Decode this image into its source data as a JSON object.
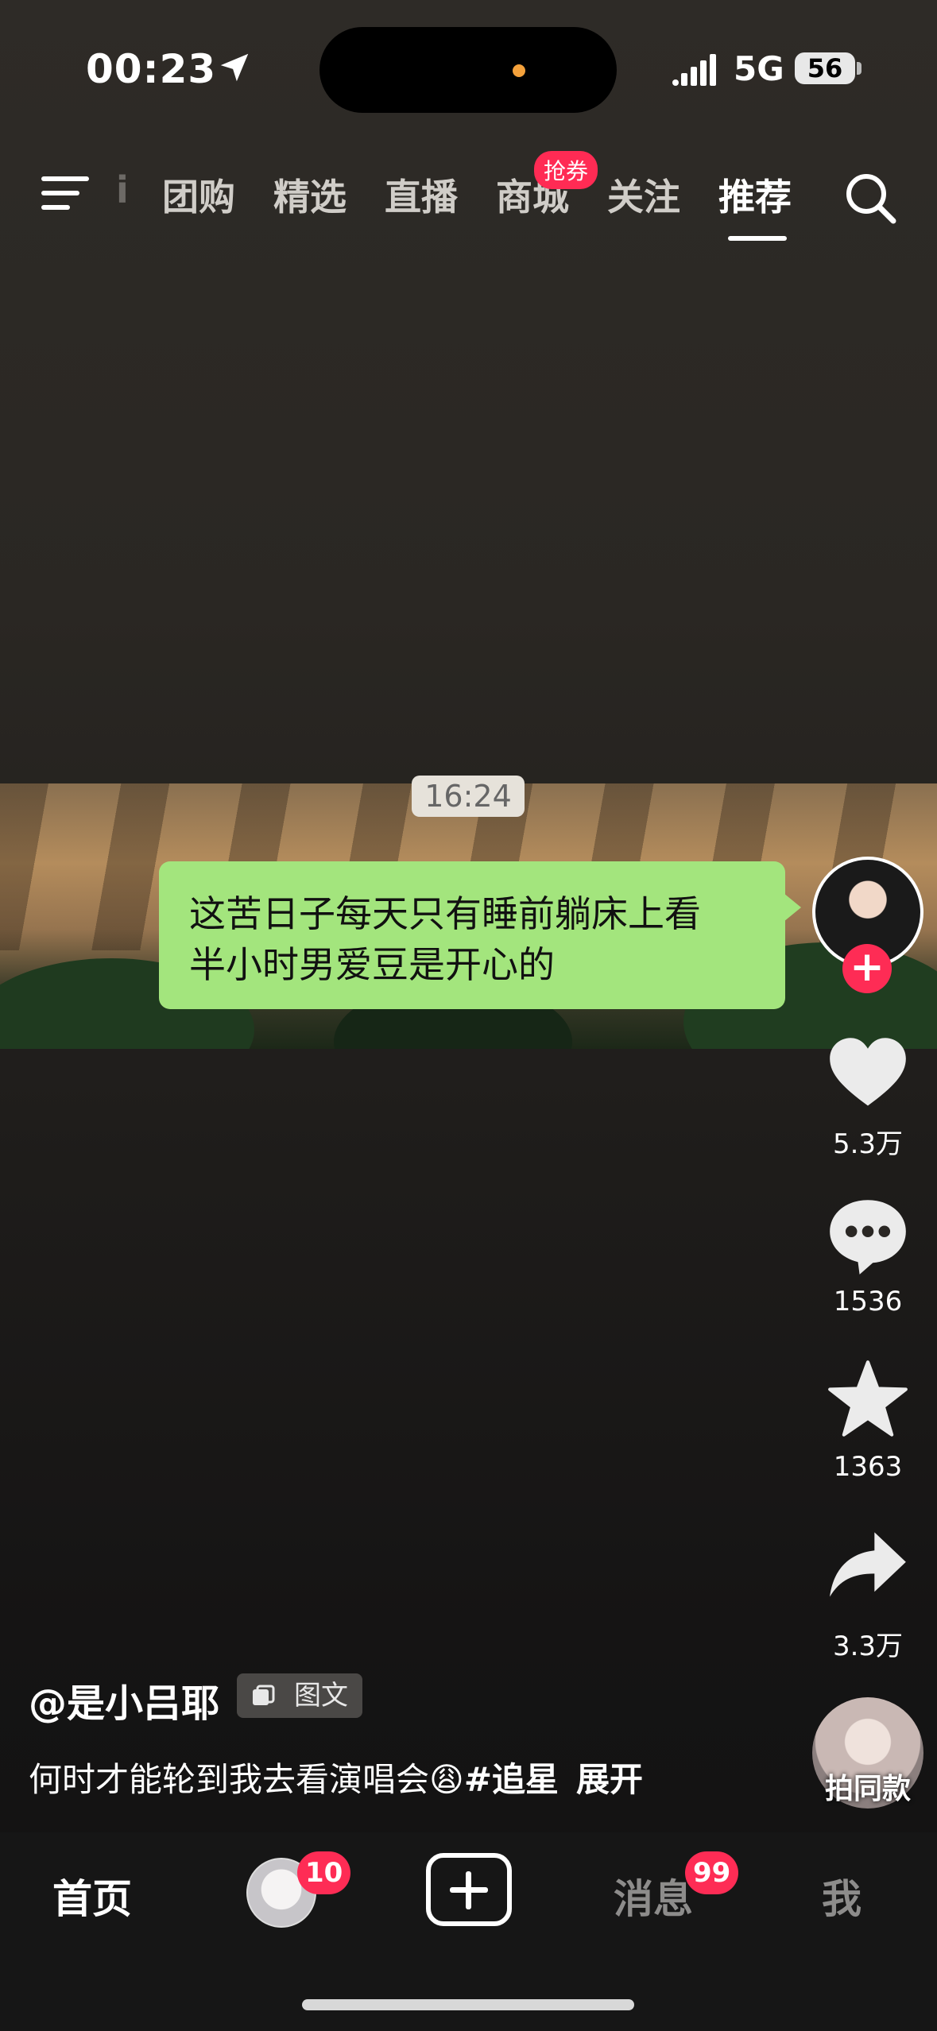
{
  "status_bar": {
    "time": "00:23",
    "network": "5G",
    "battery": "56"
  },
  "top_nav": {
    "partial_tab": "i",
    "tabs": [
      "团购",
      "精选",
      "直播",
      "商城",
      "关注",
      "推荐"
    ],
    "active_tab": "推荐",
    "coupon_badge": "抢券"
  },
  "post": {
    "timestamp_pill": "16:24",
    "bubble_text_line1": "这苦日子每天只有睡前躺床上看",
    "bubble_text_line2": "半小时男爱豆是开心的",
    "author": "@是小吕耶",
    "type_badge": "图文",
    "caption": "何时才能轮到我去看演唱会",
    "caption_emoji": "😩",
    "hashtag": "#追星",
    "expand": "展开"
  },
  "right_rail": {
    "likes": "5.3万",
    "comments": "1536",
    "favorites": "1363",
    "shares": "3.3万",
    "same_style_label": "拍同款"
  },
  "bottom_nav": {
    "home": "首页",
    "friends_badge": "10",
    "messages": "消息",
    "messages_badge": "99",
    "me": "我"
  },
  "colors": {
    "accent": "#fe2c55",
    "bubble": "#a3e57d"
  }
}
